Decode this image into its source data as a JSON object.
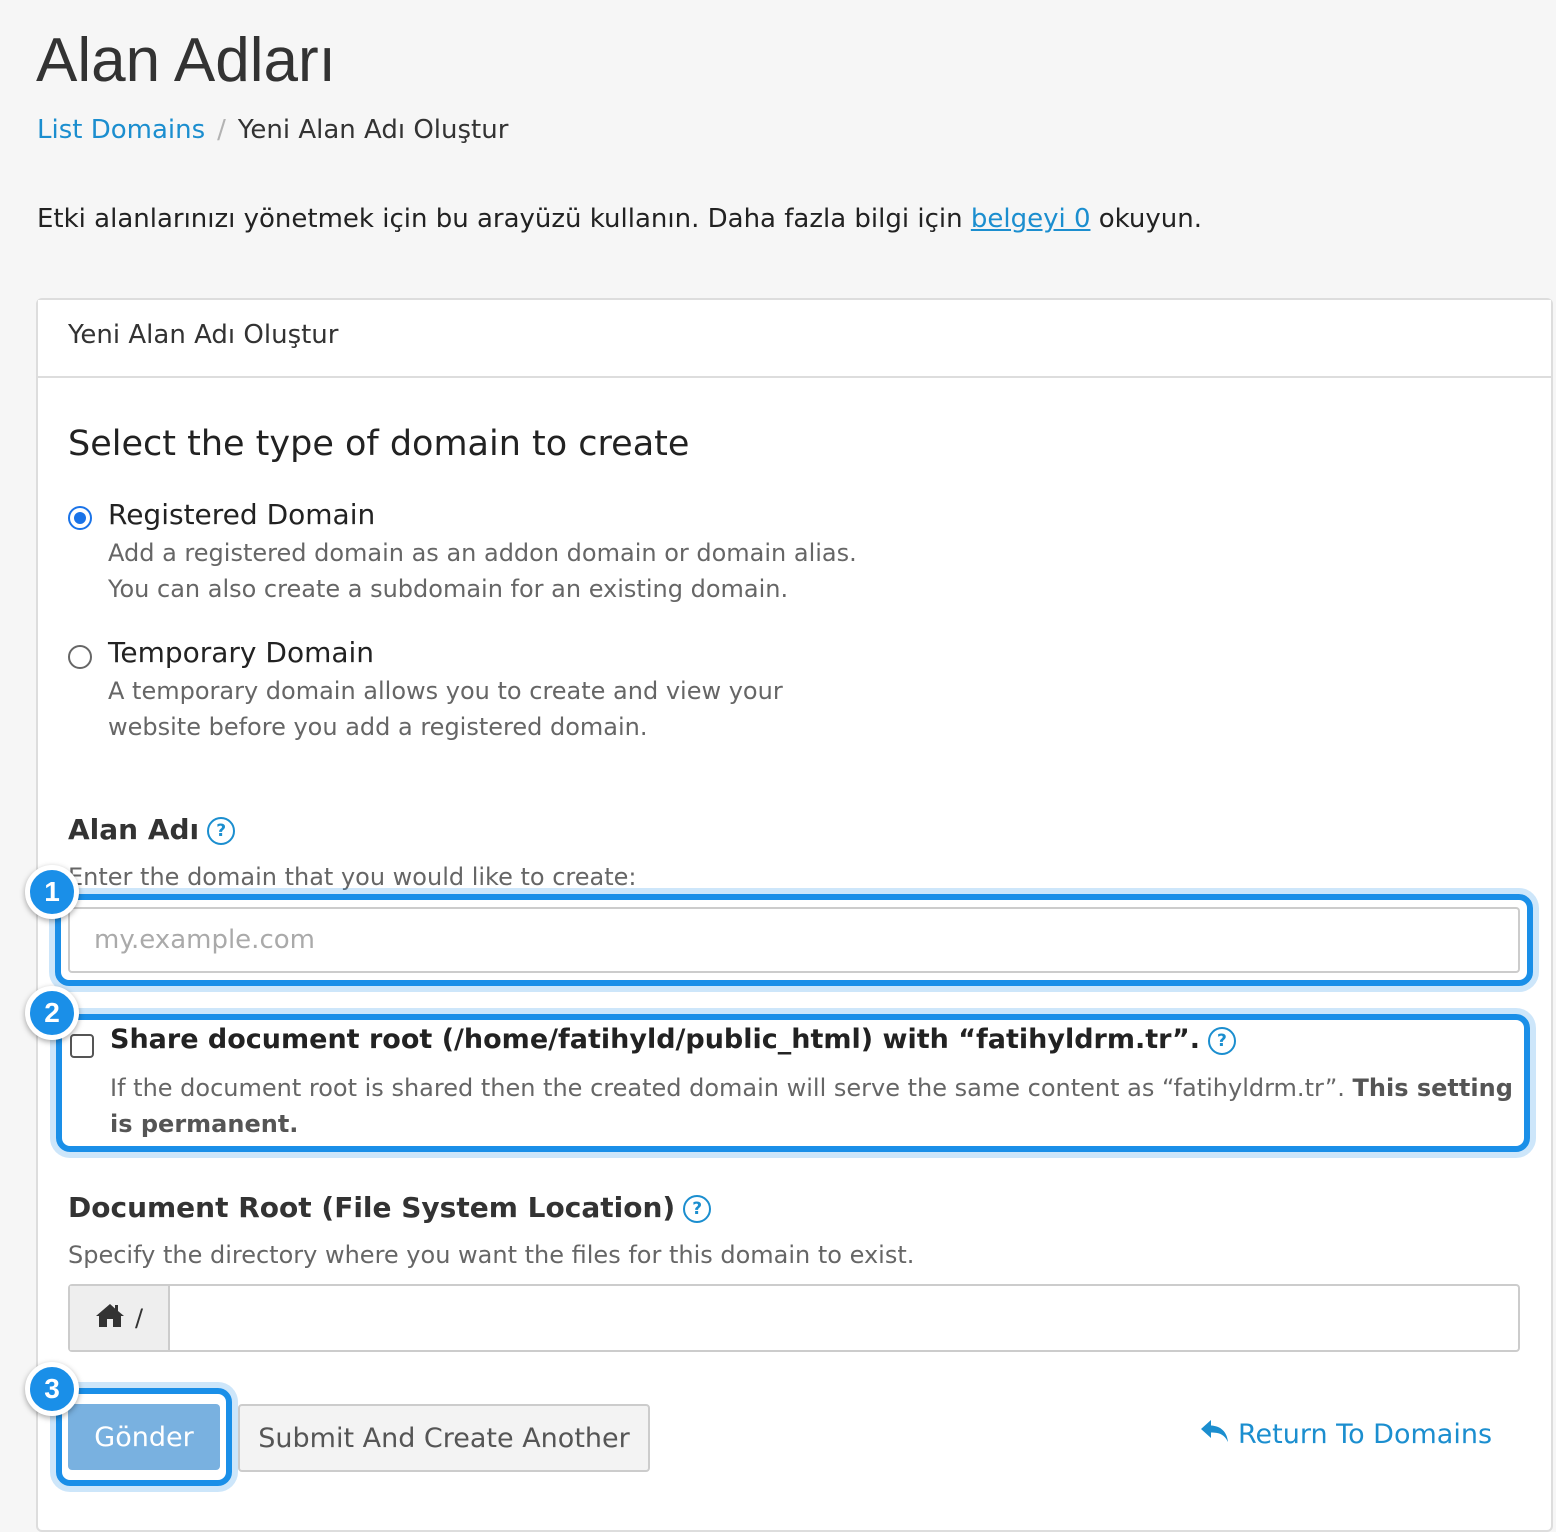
{
  "page": {
    "title": "Alan Adları"
  },
  "breadcrumb": {
    "parent": "List Domains",
    "separator": "/",
    "current": "Yeni Alan Adı Oluştur"
  },
  "intro": {
    "text_before": "Etki alanlarınızı yönetmek için bu arayüzü kullanın. Daha fazla bilgi için ",
    "link": "belgeyi 0",
    "text_after": " okuyun."
  },
  "panel": {
    "heading": "Yeni Alan Adı Oluştur",
    "section_title": "Select the type of domain to create",
    "options": [
      {
        "label": "Registered Domain",
        "desc_line1": "Add a registered domain as an addon domain or domain alias.",
        "desc_line2": "You can also create a subdomain for an existing domain.",
        "selected": true
      },
      {
        "label": "Temporary Domain",
        "desc_line1": "A temporary domain allows you to create and view your",
        "desc_line2": "website before you add a registered domain.",
        "selected": false
      }
    ],
    "domain_field": {
      "label": "Alan Adı",
      "hint": "Enter the domain that you would like to create:",
      "placeholder": "my.example.com",
      "value": ""
    },
    "share_docroot": {
      "label": "Share document root (/home/fatihyld/public_html) with “fatihyldrm.tr”.",
      "desc": "If the document root is shared then the created domain will serve the same content as “fatihyldrm.tr”. ",
      "desc_bold": "This setting is permanent.",
      "checked": false
    },
    "docroot_field": {
      "label": "Document Root (File System Location)",
      "hint": "Specify the directory where you want the files for this domain to exist.",
      "prefix": "/",
      "value": ""
    },
    "buttons": {
      "submit": "Gönder",
      "submit_another": "Submit And Create Another",
      "return": "Return To Domains"
    }
  },
  "help_icon_glyph": "?",
  "badges": [
    "1",
    "2",
    "3"
  ],
  "colors": {
    "accent": "#1a8fe8",
    "link": "#1b8ecf",
    "primary_button": "#79b1e0"
  },
  "icons": [
    "help-icon",
    "home-icon",
    "reply-arrow-icon"
  ]
}
